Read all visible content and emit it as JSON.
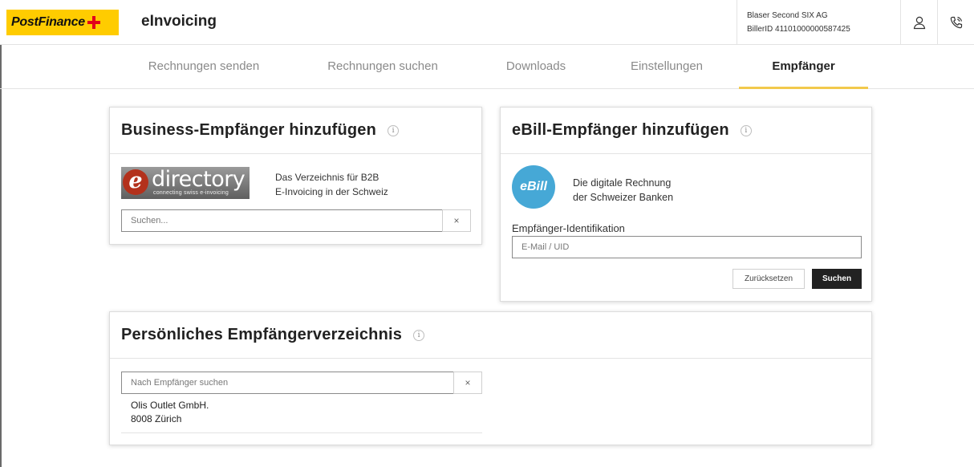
{
  "header": {
    "brand": "PostFinance",
    "app_title": "eInvoicing",
    "biller_name": "Blaser Second SIX AG",
    "biller_id": "BillerID 41101000000587425",
    "profile_icon": "user-icon",
    "contact_icon": "phone-icon"
  },
  "nav": {
    "tabs": [
      {
        "label": "Rechnungen senden",
        "active": false
      },
      {
        "label": "Rechnungen suchen",
        "active": false
      },
      {
        "label": "Downloads",
        "active": false
      },
      {
        "label": "Einstellungen",
        "active": false
      },
      {
        "label": "Empfänger",
        "active": true
      }
    ]
  },
  "business_card": {
    "title": "Business-Empfänger hinzufügen",
    "logo_word": "directory",
    "logo_letter": "e",
    "logo_sub": "connecting swiss e-invoicing",
    "description_line1": "Das Verzeichnis für B2B",
    "description_line2": "E-Invoicing in der Schweiz",
    "search_placeholder": "Suchen...",
    "clear_label": "×"
  },
  "ebill_card": {
    "title": "eBill-Empfänger hinzufügen",
    "logo_text": "eBill",
    "description_line1": "Die digitale Rechnung",
    "description_line2": "der Schweizer Banken",
    "field_label": "Empfänger-Identifikation",
    "field_placeholder": "E-Mail / UID",
    "reset_label": "Zurücksetzen",
    "search_label": "Suchen"
  },
  "personal_card": {
    "title": "Persönliches Empfängerverzeichnis",
    "search_placeholder": "Nach Empfänger suchen",
    "clear_label": "×",
    "results": [
      {
        "name": "Olis Outlet GmbH.",
        "address": "8008 Zürich"
      }
    ]
  },
  "colors": {
    "brand_yellow": "#ffcc00",
    "brand_red": "#e2001a",
    "active_tab_underline": "#f2c94c",
    "ebill_blue": "#46a8d6",
    "primary_button": "#222222"
  }
}
